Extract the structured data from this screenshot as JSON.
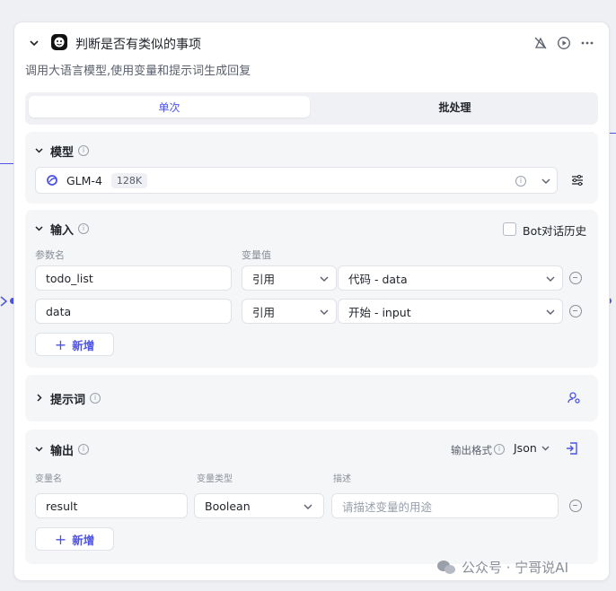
{
  "node": {
    "title": "判断是否有类似的事项",
    "subtitle": "调用大语言模型,使用变量和提示词生成回复"
  },
  "tabs": {
    "single": "单次",
    "batch": "批处理"
  },
  "model_section": {
    "title": "模型",
    "model_name": "GLM-4",
    "context_badge": "128K"
  },
  "input_section": {
    "title": "输入",
    "history_label": "Bot对话历史",
    "col_param": "参数名",
    "col_value": "变量值",
    "rows": [
      {
        "name": "todo_list",
        "type": "引用",
        "value": "代码 - data"
      },
      {
        "name": "data",
        "type": "引用",
        "value": "开始 - input"
      }
    ],
    "add_label": "新增"
  },
  "prompt_section": {
    "title": "提示词"
  },
  "output_section": {
    "title": "输出",
    "format_label": "输出格式",
    "format_value": "Json",
    "col_name": "变量名",
    "col_type": "变量类型",
    "col_desc": "描述",
    "row": {
      "name": "result",
      "type": "Boolean",
      "desc_placeholder": "请描述变量的用途"
    },
    "add_label": "新增"
  },
  "watermark": "公众号 · 宁哥说AI"
}
